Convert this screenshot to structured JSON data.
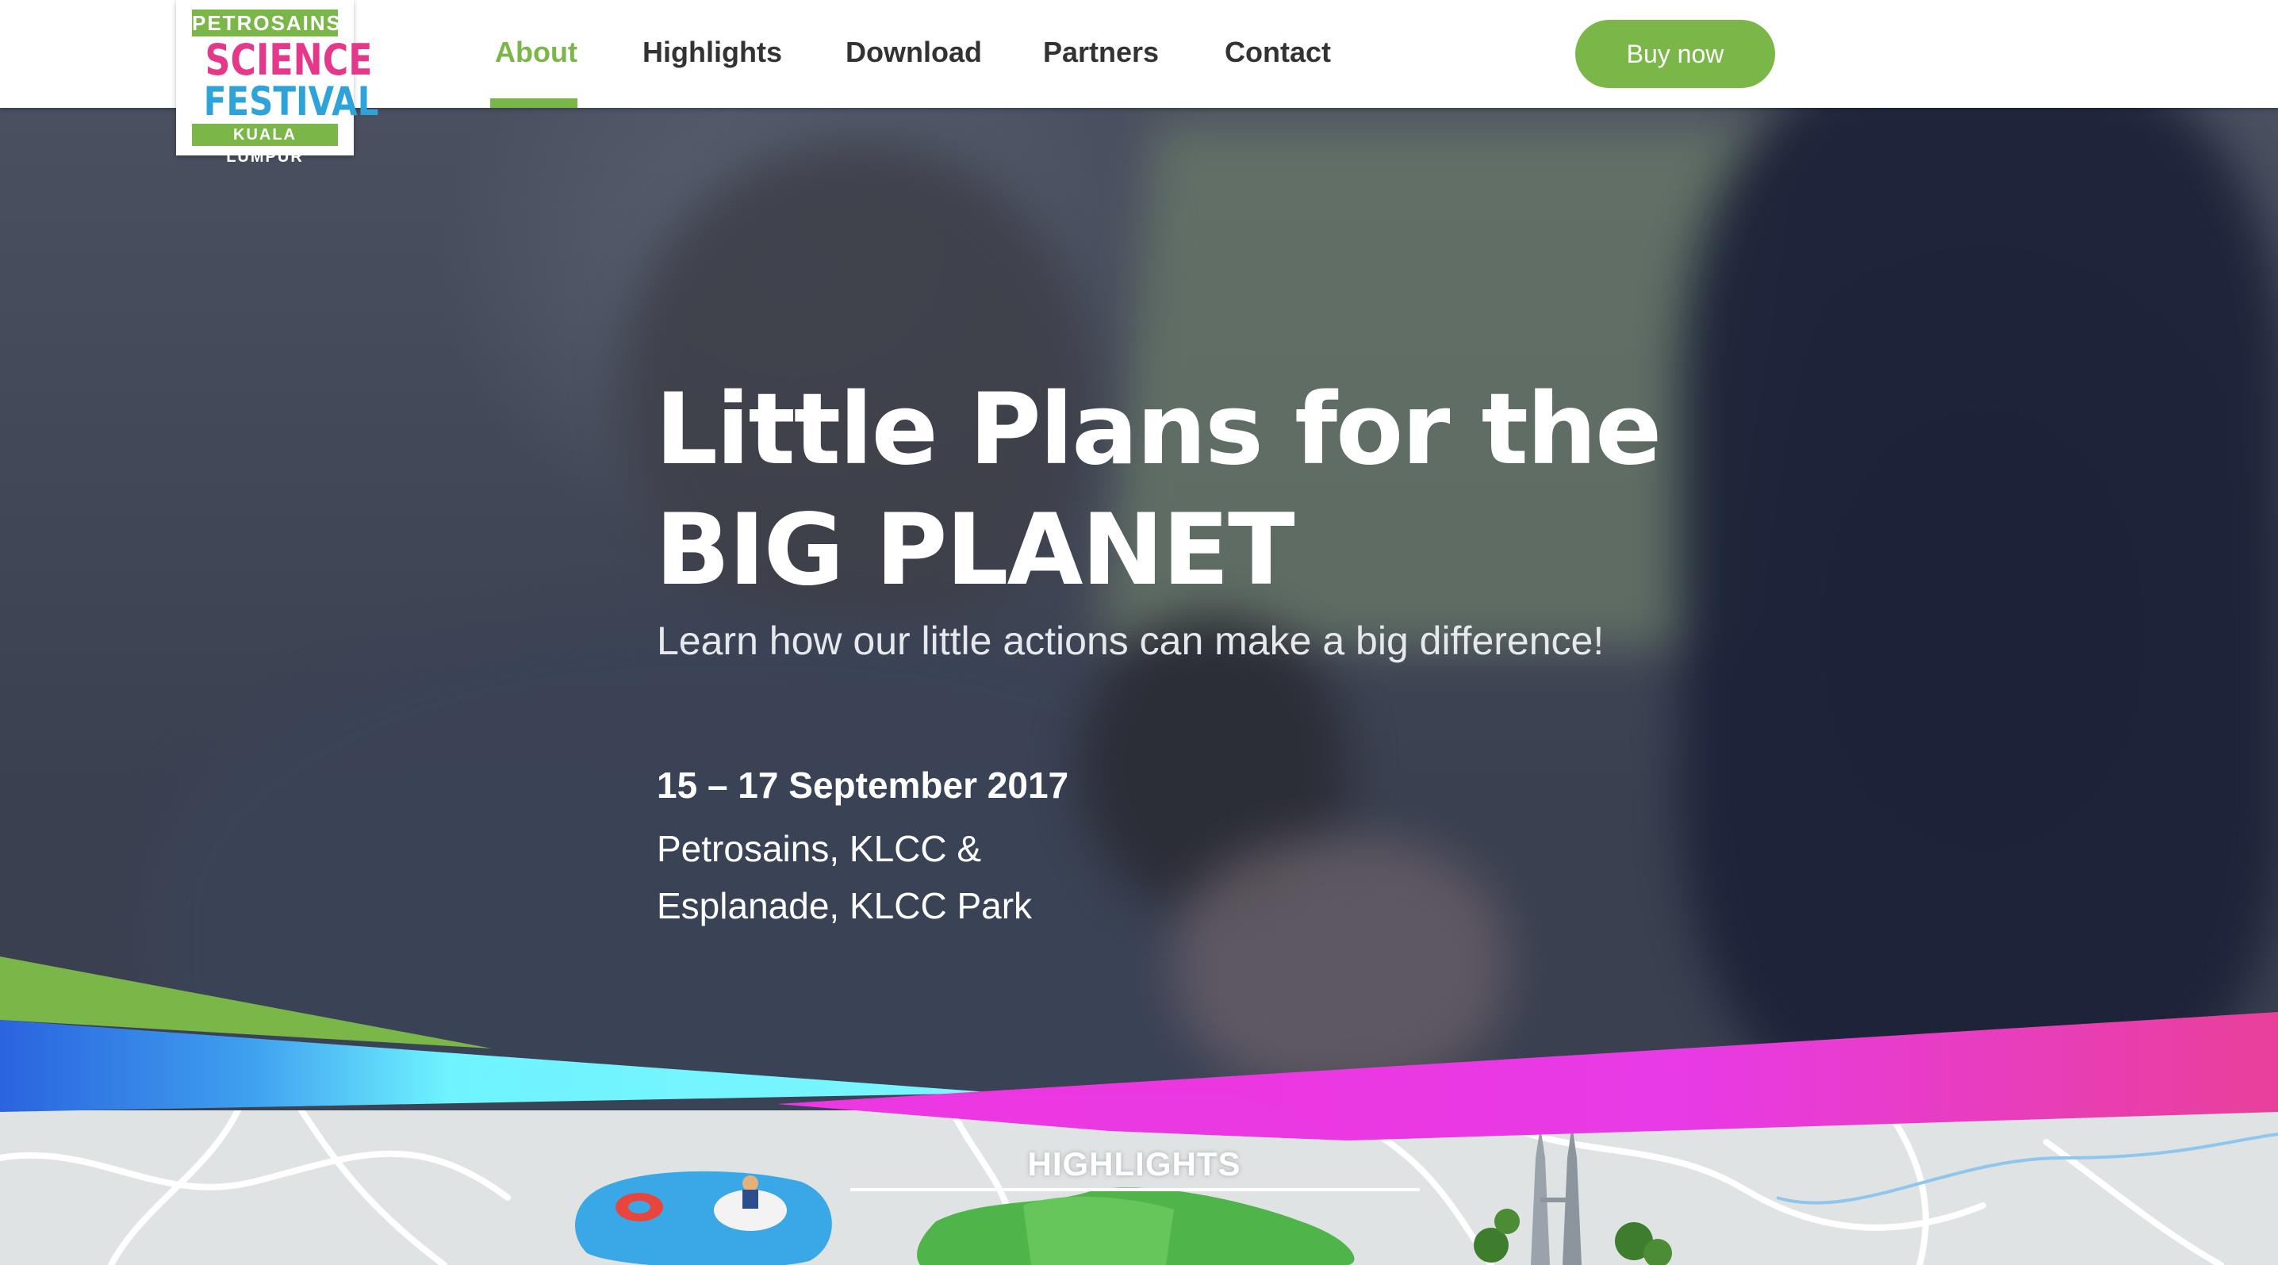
{
  "logo": {
    "top": "PETROSAINS",
    "line1": "SCIENCE",
    "line2": "FESTIVAL",
    "bottom": "KUALA LUMPUR"
  },
  "nav": {
    "items": [
      {
        "label": "About",
        "active": true
      },
      {
        "label": "Highlights",
        "active": false
      },
      {
        "label": "Download",
        "active": false
      },
      {
        "label": "Partners",
        "active": false
      },
      {
        "label": "Contact",
        "active": false
      }
    ],
    "buy_label": "Buy now"
  },
  "hero": {
    "title_line1": "Little Plans for the",
    "title_line2": "BIG PLANET",
    "subtitle": "Learn how our little actions can make a big difference!",
    "date": "15 – 17 September 2017",
    "location_line1": "Petrosains, KLCC &",
    "location_line2": "Esplanade, KLCC Park"
  },
  "highlights_section": {
    "label": "HIGHLIGHTS"
  },
  "colors": {
    "brand_green": "#7ab648",
    "brand_pink": "#e6388a",
    "brand_blue": "#2ea3d9",
    "wave_magenta": "#e83ae6",
    "wave_cyan": "#6ff4ff"
  }
}
